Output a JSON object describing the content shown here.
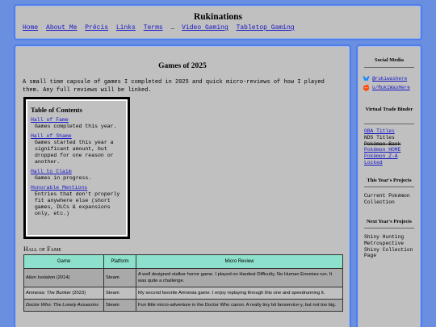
{
  "header": {
    "site_title": "Rukinations",
    "nav": [
      "Home",
      "About Me",
      "Précis",
      "Links",
      "Terms"
    ],
    "nav_sep": "…",
    "nav_extra": [
      "Video Gaming",
      "Tabletop Gaming"
    ]
  },
  "main": {
    "heading": "Games of 2025",
    "intro": "A small time capsule of games I completed in 2025 and quick micro-reviews of how I played them. Any full reviews will be linked.",
    "toc": {
      "title": "Table of Contents",
      "items": [
        {
          "link": "Hall of Fame",
          "desc": "Games completed this year."
        },
        {
          "link": "Hall of Shame",
          "desc": "Games started this year a significant amount, but dropped for one reason or another."
        },
        {
          "link": "Hall to Claim",
          "desc": "Games in progress."
        },
        {
          "link": "Honorable Mentions",
          "desc": "Entries that don't properly fit anywhere else (short games, DLCs & expansions only, etc.)"
        }
      ]
    },
    "hof_heading": "Hall of Fame",
    "table": {
      "headers": [
        "Game",
        "Platform",
        "Micro Review"
      ],
      "rows": [
        {
          "title": "Alien Isolation",
          "year": "(2014)",
          "platform": "Steam",
          "review": "A well designed stalker horror game. I played on Hardest Difficulty, No Human Enemies run. It was quite a challenge."
        },
        {
          "title": "Amnesia: The Bunker",
          "year": "(2023)",
          "platform": "Steam",
          "review": "My second favorite Amnesia game. I enjoy replaying through this one and speedrunning it."
        },
        {
          "title": "Doctor Who: The Lonely Assassins",
          "year": "",
          "platform": "Steam",
          "review": "Fun little micro-adventure in the Doctor Who canon. A really tiny bit fanservice-y, but not too big."
        }
      ]
    }
  },
  "sidebar": {
    "social_heading": "Social Media",
    "social": [
      {
        "icon": "bluesky-icon",
        "label": "@rukiwashere",
        "color": "#1185fe"
      },
      {
        "icon": "reddit-icon",
        "label": "u/RukiWasHere",
        "color": "#ff4500"
      }
    ],
    "binder_heading": "Virtual Trade Binder",
    "binder": [
      {
        "label": "GBA Titles",
        "style": "link"
      },
      {
        "label": "NDS Titles",
        "style": "plain"
      },
      {
        "label": "Pokémon Bank",
        "style": "strike"
      },
      {
        "label": "Pokémon HOME",
        "style": "link"
      },
      {
        "label": "Pokémon Z-A",
        "style": "link"
      },
      {
        "label": "Locked",
        "style": "link"
      }
    ],
    "this_year_heading": "This Year's Projects",
    "this_year": [
      "Current Pokémon",
      "Collection"
    ],
    "next_year_heading": "Next Year's Projects",
    "next_year": [
      "Shiny Hunting",
      "Metrospective",
      "Shiny Collection",
      "Page"
    ]
  }
}
